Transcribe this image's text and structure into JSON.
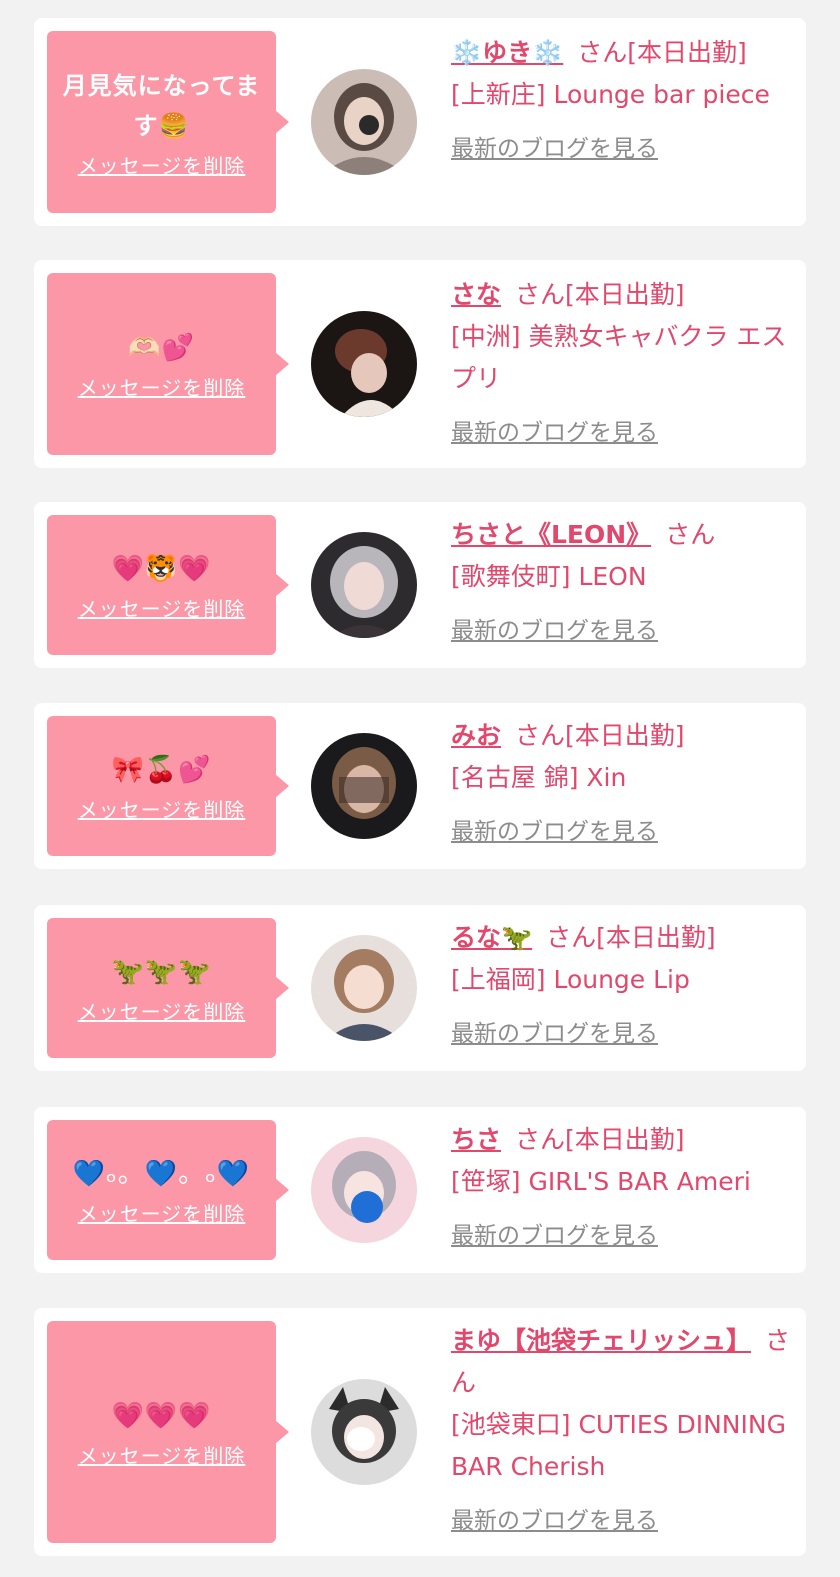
{
  "colors": {
    "accent": "#e2476c",
    "bubble": "#fb97a6",
    "link_gray": "#8c8c8c",
    "background": "#f2f2f3"
  },
  "delete_label": "メッセージを削除",
  "blog_label": "最新のブログを見る",
  "items": [
    {
      "message": "月見気になってます🍔",
      "name": "❄️ゆき❄️",
      "suffix": "さん[本日出勤]",
      "shop": "[上新庄] Lounge bar piece"
    },
    {
      "message": "🫶🏻💕",
      "name": "さな",
      "suffix": "さん[本日出勤]",
      "shop": "[中洲] 美熟女キャバクラ エスプリ"
    },
    {
      "message": "💗🐯💗",
      "name": "ちさと《LEON》",
      "suffix": "さん",
      "shop": "[歌舞伎町] LEON"
    },
    {
      "message": "🎀🍒💕",
      "name": "みお",
      "suffix": "さん[本日出勤]",
      "shop": "[名古屋 錦] Xin"
    },
    {
      "message": "🦖🦖🦖",
      "name": "るな🦖",
      "suffix": "さん[本日出勤]",
      "shop": "[上福岡] Lounge Lip"
    },
    {
      "message": "💙ₒ。💙。ₒ💙",
      "name": "ちさ",
      "suffix": "さん[本日出勤]",
      "shop": "[笹塚] GIRL'S BAR Ameri"
    },
    {
      "message": "💗💗💗",
      "name": "まゆ【池袋チェリッシュ】",
      "suffix": "さん",
      "shop": "[池袋東口] CUTIES DINNING BAR Cherish"
    }
  ]
}
